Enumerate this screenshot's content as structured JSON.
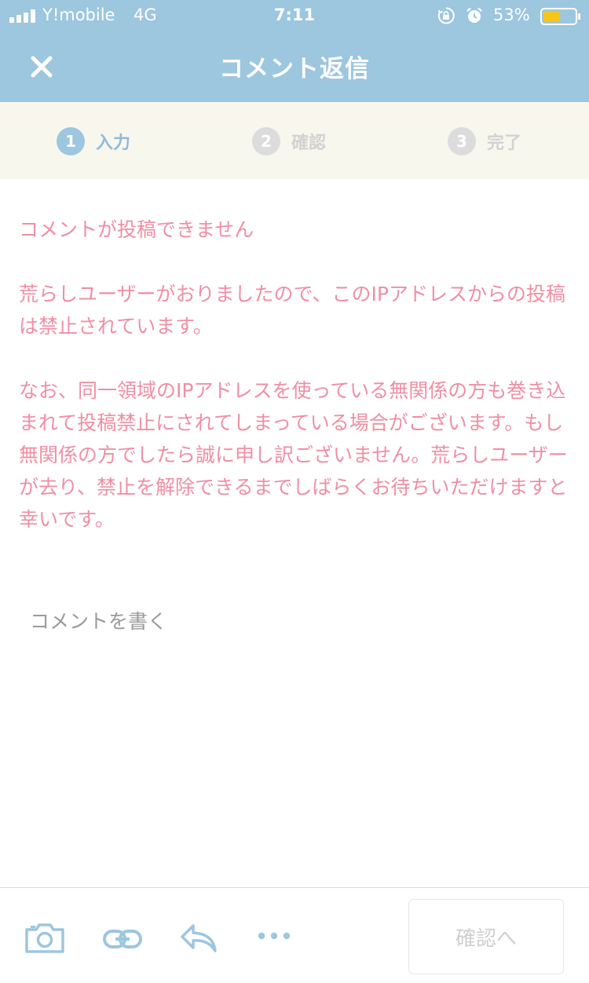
{
  "status_bar": {
    "carrier": "Y!mobile",
    "network": "4G",
    "time": "7:11",
    "battery_percent": "53%",
    "battery_level": 0.53,
    "icons": [
      "signal-icon",
      "orientation-lock-icon",
      "alarm-icon",
      "battery-icon"
    ]
  },
  "header": {
    "title": "コメント返信",
    "close_icon": "close-icon"
  },
  "steps": [
    {
      "number": "1",
      "label": "入力",
      "active": true
    },
    {
      "number": "2",
      "label": "確認",
      "active": false
    },
    {
      "number": "3",
      "label": "完了",
      "active": false
    }
  ],
  "error": {
    "heading": "コメントが投稿できません",
    "paragraph1": "荒らしユーザーがおりましたので、このIPアドレスからの投稿は禁止されています。",
    "paragraph2": "なお、同一領域のIPアドレスを使っている無関係の方も巻き込まれて投稿禁止にされてしまっている場合がございます。もし無関係の方でしたら誠に申し訳ございません。荒らしユーザーが去り、禁止を解除できるまでしばらくお待ちいただけますと幸いです。"
  },
  "comment": {
    "placeholder": "コメントを書く"
  },
  "toolbar": {
    "icons": [
      "camera-icon",
      "link-icon",
      "reply-icon",
      "more-icon"
    ],
    "confirm_label": "確認へ"
  },
  "colors": {
    "primary_blue": "#9dc6df",
    "error_pink": "#ef8fa4",
    "steps_bg": "#f8f7ee",
    "inactive_gray": "#dcdcdc",
    "battery_yellow": "#f5c518"
  }
}
